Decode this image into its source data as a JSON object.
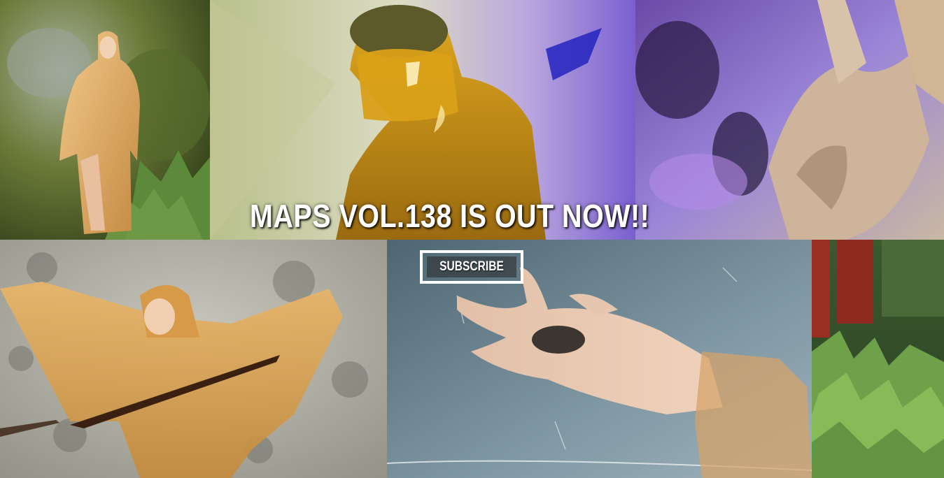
{
  "headline": "MAPS VOL.138 IS OUT NOW!!",
  "subscribe": {
    "label": "SUBSCRIBE"
  },
  "colors": {
    "moss": "#6a7a2c",
    "latex_amber": "#d9a24a",
    "purple_haze": "#8a6ad8",
    "slate_blue": "#6f8794",
    "forest_green": "#4f7a36",
    "redwood": "#9a2e22"
  },
  "tiles": [
    {
      "name": "photo-woman-moss-rock",
      "interactable": false
    },
    {
      "name": "photo-yellow-latex-hood",
      "interactable": false
    },
    {
      "name": "photo-sculpture-purple",
      "interactable": false
    },
    {
      "name": "photo-woman-cape-rock",
      "interactable": false
    },
    {
      "name": "photo-hand-stone",
      "interactable": false
    },
    {
      "name": "photo-forest-ferns",
      "interactable": false
    }
  ]
}
